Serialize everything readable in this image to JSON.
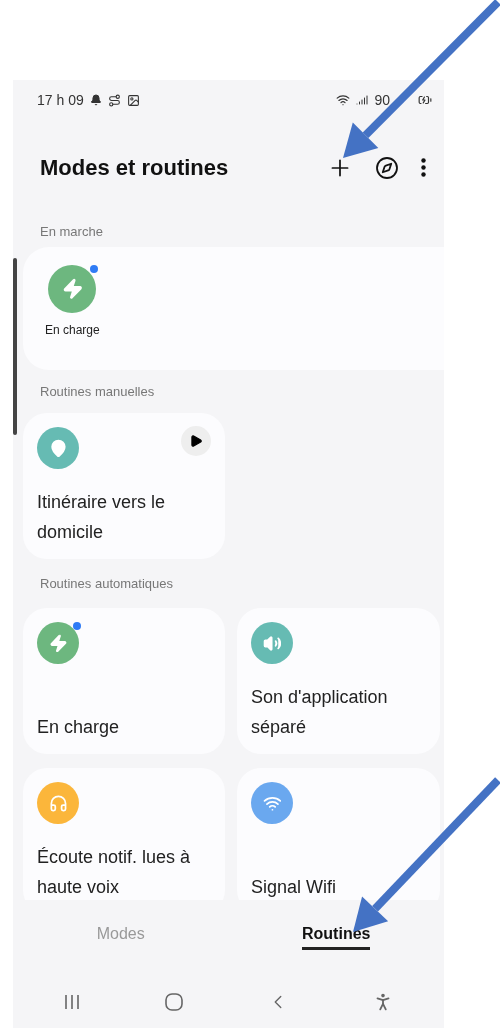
{
  "status_bar": {
    "time": "17 h 09",
    "battery": "90"
  },
  "header": {
    "title": "Modes et routines"
  },
  "sections": [
    {
      "title": "En marche",
      "kind": "wide",
      "items": [
        {
          "label": "En charge",
          "kind": "bolt",
          "color": "#6db77f",
          "badge": true
        }
      ]
    },
    {
      "title": "Routines manuelles",
      "kind": "grid",
      "items": [
        {
          "label": "Itinéraire vers le domicile",
          "kind": "pin",
          "color": "#66bbb3",
          "badge": false,
          "play_button": true
        }
      ]
    },
    {
      "title": "Routines automatiques",
      "kind": "grid",
      "items": [
        {
          "label": "En charge",
          "kind": "bolt",
          "color": "#6db77f",
          "badge": true,
          "play_button": false
        },
        {
          "label": "Son d'application séparé",
          "kind": "volume",
          "color": "#66bbb3",
          "badge": false,
          "play_button": false
        },
        {
          "label": "Écoute notif. lues à haute voix",
          "kind": "headphones",
          "color": "#fbb63b",
          "badge": false,
          "play_button": false
        },
        {
          "label": "Signal Wifi",
          "kind": "wifi",
          "color": "#6aa8ef",
          "badge": false,
          "play_button": false
        }
      ]
    }
  ],
  "tabs": [
    {
      "label": "Modes",
      "selected": false
    },
    {
      "label": "Routines",
      "selected": true
    }
  ]
}
